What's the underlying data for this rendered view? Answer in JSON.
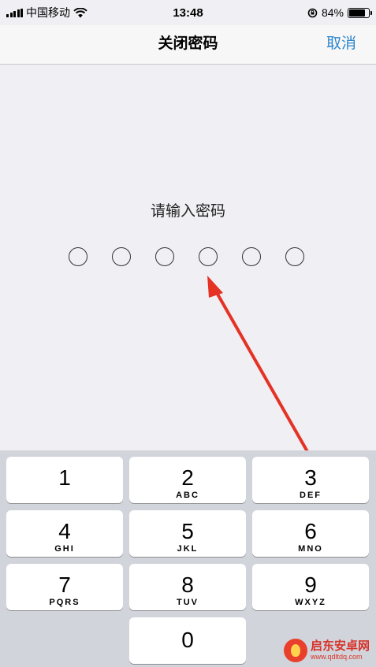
{
  "status_bar": {
    "carrier": "中国移动",
    "time": "13:48",
    "battery_percent": "84%",
    "battery_level": 0.84,
    "icons": [
      "signal-icon",
      "wifi-icon",
      "orientation-lock-icon",
      "battery-icon"
    ]
  },
  "nav": {
    "title": "关闭密码",
    "cancel_label": "取消"
  },
  "passcode": {
    "prompt": "请输入密码",
    "dot_count": 6,
    "filled": 0
  },
  "keypad": {
    "keys": [
      {
        "num": "1",
        "letters": ""
      },
      {
        "num": "2",
        "letters": "ABC"
      },
      {
        "num": "3",
        "letters": "DEF"
      },
      {
        "num": "4",
        "letters": "GHI"
      },
      {
        "num": "5",
        "letters": "JKL"
      },
      {
        "num": "6",
        "letters": "MNO"
      },
      {
        "num": "7",
        "letters": "PQRS"
      },
      {
        "num": "8",
        "letters": "TUV"
      },
      {
        "num": "9",
        "letters": "WXYZ"
      },
      {
        "num": "0",
        "letters": ""
      }
    ]
  },
  "annotation": {
    "arrow_color": "#e53224"
  },
  "watermark": {
    "name": "启东安卓网",
    "url": "www.qdltdq.com"
  },
  "colors": {
    "accent": "#2d86cc",
    "keypad_bg": "#d1d4da",
    "page_bg": "#efeff4"
  }
}
